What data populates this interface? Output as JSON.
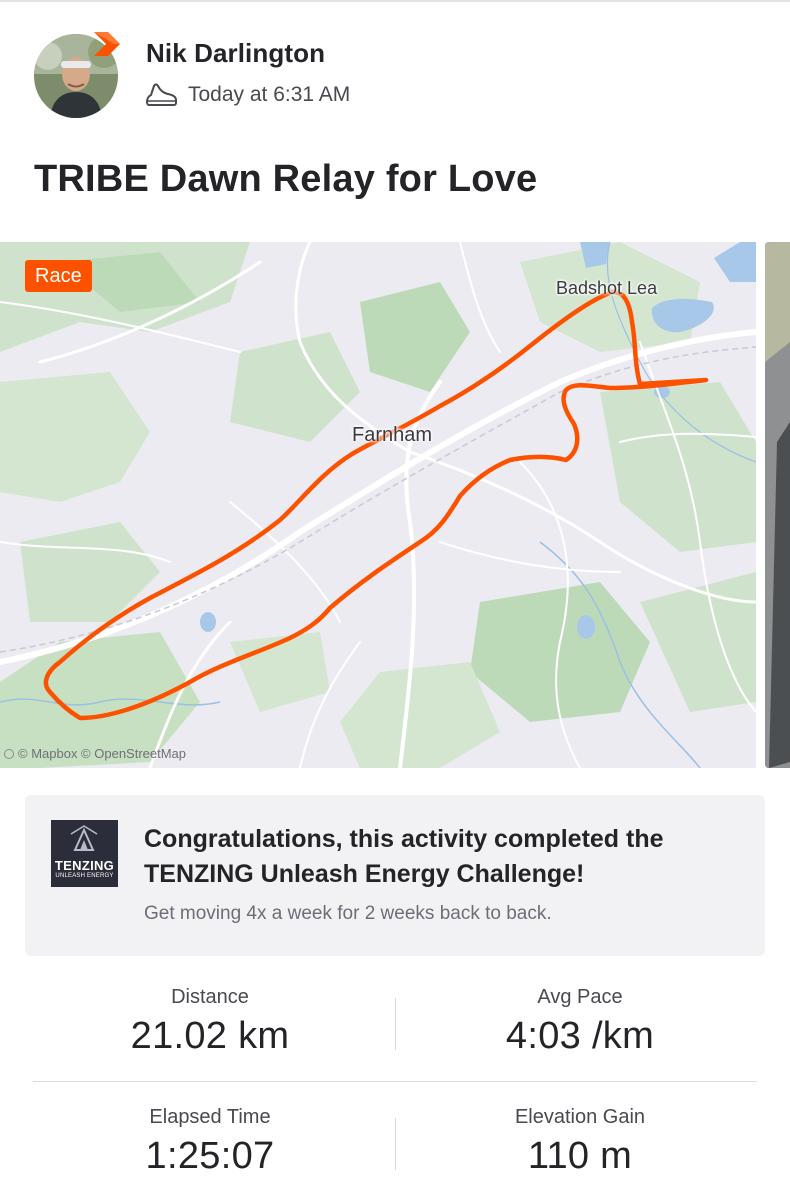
{
  "athlete": {
    "name": "Nik Darlington",
    "activity_time": "Today at 6:31 AM",
    "activity_type_icon": "running-shoe-icon",
    "badge_icon": "subscriber-badge-icon"
  },
  "activity": {
    "title": "TRIBE Dawn Relay for Love"
  },
  "map": {
    "tag": "Race",
    "places": {
      "badshot_lea": "Badshot Lea",
      "farnham": "Farnham"
    },
    "attribution": "© Mapbox © OpenStreetMap",
    "route_color": "#fc5200"
  },
  "challenge": {
    "logo_text": "TENZING",
    "logo_subtext": "UNLEASH ENERGY",
    "headline": "Congratulations, this activity completed the TENZING Unleash Energy Challenge!",
    "description": "Get moving 4x a week for 2 weeks back to back."
  },
  "stats": {
    "distance": {
      "label": "Distance",
      "value": "21.02 km"
    },
    "pace": {
      "label": "Avg Pace",
      "value": "4:03 /km"
    },
    "elapsed": {
      "label": "Elapsed Time",
      "value": "1:25:07"
    },
    "elevation": {
      "label": "Elevation Gain",
      "value": "110 m"
    }
  },
  "colors": {
    "brand": "#fc5200",
    "card_bg": "#f2f2f4",
    "text_primary": "#242428"
  }
}
